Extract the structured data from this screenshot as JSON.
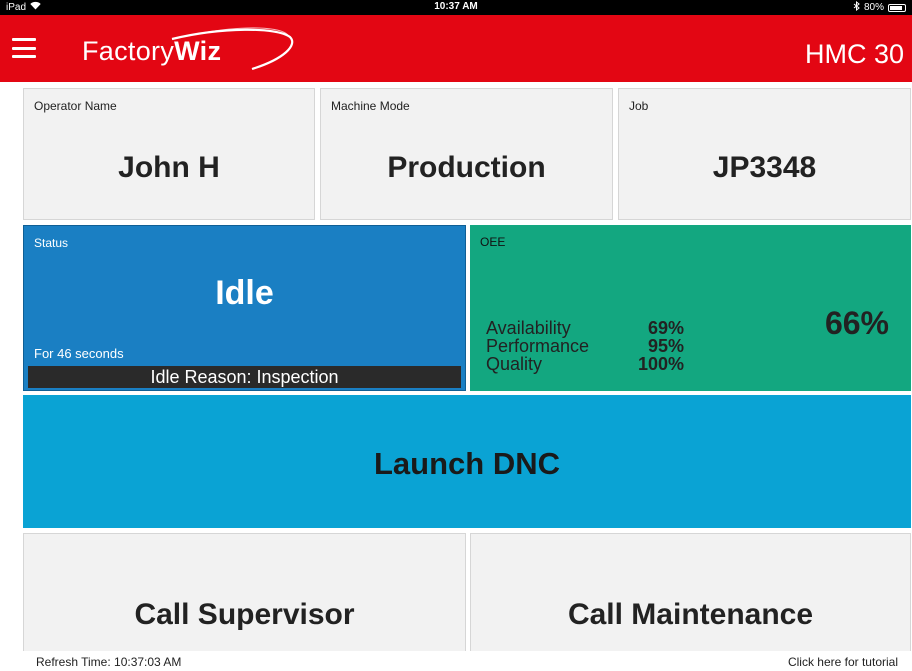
{
  "status_bar": {
    "device": "iPad",
    "wifi_icon": "wifi-icon",
    "time": "10:37 AM",
    "bluetooth_icon": "bluetooth-icon",
    "battery": "80%"
  },
  "header": {
    "menu_icon": "hamburger-menu-icon",
    "logo": "FactoryWiz",
    "logo_trademark": "TM",
    "machine": "HMC 30",
    "background_color": "#e30613"
  },
  "info": {
    "operator": {
      "label": "Operator Name",
      "value": "John H"
    },
    "mode": {
      "label": "Machine Mode",
      "value": "Production"
    },
    "job": {
      "label": "Job",
      "value": "JP3348"
    }
  },
  "status": {
    "label": "Status",
    "value": "Idle",
    "duration": "For 46 seconds",
    "reason": "Idle Reason: Inspection",
    "color": "#1a7fc3"
  },
  "oee": {
    "label": "OEE",
    "total": "66%",
    "color": "#13a780",
    "metrics": [
      {
        "name": "Availability",
        "value": "69%"
      },
      {
        "name": "Performance",
        "value": "95%"
      },
      {
        "name": "Quality",
        "value": "100%"
      }
    ]
  },
  "actions": {
    "dnc": "Launch DNC",
    "supervisor": "Call Supervisor",
    "maintenance": "Call Maintenance",
    "dnc_color": "#0aa3d4"
  },
  "footer": {
    "refresh": "Refresh Time: 10:37:03 AM",
    "tutorial": "Click here for tutorial"
  }
}
